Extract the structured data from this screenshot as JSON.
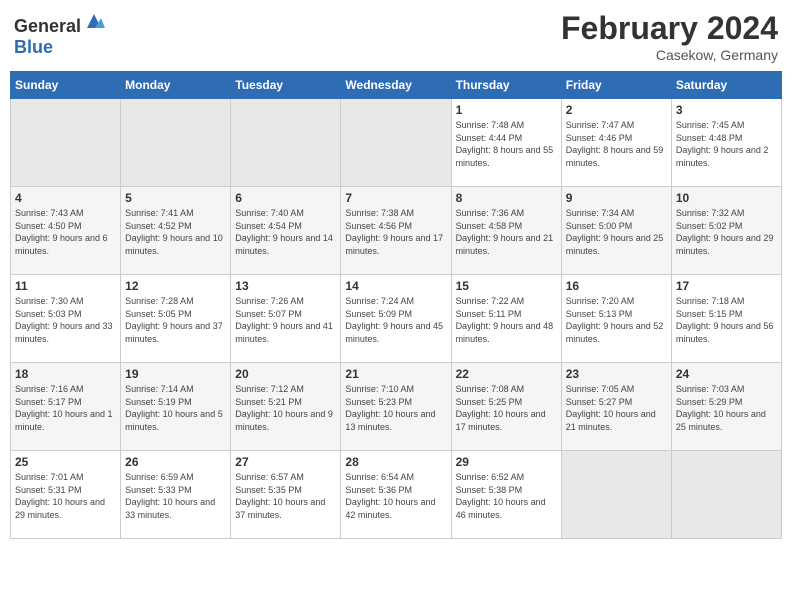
{
  "header": {
    "logo_general": "General",
    "logo_blue": "Blue",
    "title": "February 2024",
    "location": "Casekow, Germany"
  },
  "days_of_week": [
    "Sunday",
    "Monday",
    "Tuesday",
    "Wednesday",
    "Thursday",
    "Friday",
    "Saturday"
  ],
  "weeks": [
    [
      {
        "day": "",
        "sunrise": "",
        "sunset": "",
        "daylight": "",
        "empty": true
      },
      {
        "day": "",
        "sunrise": "",
        "sunset": "",
        "daylight": "",
        "empty": true
      },
      {
        "day": "",
        "sunrise": "",
        "sunset": "",
        "daylight": "",
        "empty": true
      },
      {
        "day": "",
        "sunrise": "",
        "sunset": "",
        "daylight": "",
        "empty": true
      },
      {
        "day": "1",
        "sunrise": "Sunrise: 7:48 AM",
        "sunset": "Sunset: 4:44 PM",
        "daylight": "Daylight: 8 hours and 55 minutes.",
        "empty": false
      },
      {
        "day": "2",
        "sunrise": "Sunrise: 7:47 AM",
        "sunset": "Sunset: 4:46 PM",
        "daylight": "Daylight: 8 hours and 59 minutes.",
        "empty": false
      },
      {
        "day": "3",
        "sunrise": "Sunrise: 7:45 AM",
        "sunset": "Sunset: 4:48 PM",
        "daylight": "Daylight: 9 hours and 2 minutes.",
        "empty": false
      }
    ],
    [
      {
        "day": "4",
        "sunrise": "Sunrise: 7:43 AM",
        "sunset": "Sunset: 4:50 PM",
        "daylight": "Daylight: 9 hours and 6 minutes.",
        "empty": false
      },
      {
        "day": "5",
        "sunrise": "Sunrise: 7:41 AM",
        "sunset": "Sunset: 4:52 PM",
        "daylight": "Daylight: 9 hours and 10 minutes.",
        "empty": false
      },
      {
        "day": "6",
        "sunrise": "Sunrise: 7:40 AM",
        "sunset": "Sunset: 4:54 PM",
        "daylight": "Daylight: 9 hours and 14 minutes.",
        "empty": false
      },
      {
        "day": "7",
        "sunrise": "Sunrise: 7:38 AM",
        "sunset": "Sunset: 4:56 PM",
        "daylight": "Daylight: 9 hours and 17 minutes.",
        "empty": false
      },
      {
        "day": "8",
        "sunrise": "Sunrise: 7:36 AM",
        "sunset": "Sunset: 4:58 PM",
        "daylight": "Daylight: 9 hours and 21 minutes.",
        "empty": false
      },
      {
        "day": "9",
        "sunrise": "Sunrise: 7:34 AM",
        "sunset": "Sunset: 5:00 PM",
        "daylight": "Daylight: 9 hours and 25 minutes.",
        "empty": false
      },
      {
        "day": "10",
        "sunrise": "Sunrise: 7:32 AM",
        "sunset": "Sunset: 5:02 PM",
        "daylight": "Daylight: 9 hours and 29 minutes.",
        "empty": false
      }
    ],
    [
      {
        "day": "11",
        "sunrise": "Sunrise: 7:30 AM",
        "sunset": "Sunset: 5:03 PM",
        "daylight": "Daylight: 9 hours and 33 minutes.",
        "empty": false
      },
      {
        "day": "12",
        "sunrise": "Sunrise: 7:28 AM",
        "sunset": "Sunset: 5:05 PM",
        "daylight": "Daylight: 9 hours and 37 minutes.",
        "empty": false
      },
      {
        "day": "13",
        "sunrise": "Sunrise: 7:26 AM",
        "sunset": "Sunset: 5:07 PM",
        "daylight": "Daylight: 9 hours and 41 minutes.",
        "empty": false
      },
      {
        "day": "14",
        "sunrise": "Sunrise: 7:24 AM",
        "sunset": "Sunset: 5:09 PM",
        "daylight": "Daylight: 9 hours and 45 minutes.",
        "empty": false
      },
      {
        "day": "15",
        "sunrise": "Sunrise: 7:22 AM",
        "sunset": "Sunset: 5:11 PM",
        "daylight": "Daylight: 9 hours and 48 minutes.",
        "empty": false
      },
      {
        "day": "16",
        "sunrise": "Sunrise: 7:20 AM",
        "sunset": "Sunset: 5:13 PM",
        "daylight": "Daylight: 9 hours and 52 minutes.",
        "empty": false
      },
      {
        "day": "17",
        "sunrise": "Sunrise: 7:18 AM",
        "sunset": "Sunset: 5:15 PM",
        "daylight": "Daylight: 9 hours and 56 minutes.",
        "empty": false
      }
    ],
    [
      {
        "day": "18",
        "sunrise": "Sunrise: 7:16 AM",
        "sunset": "Sunset: 5:17 PM",
        "daylight": "Daylight: 10 hours and 1 minute.",
        "empty": false
      },
      {
        "day": "19",
        "sunrise": "Sunrise: 7:14 AM",
        "sunset": "Sunset: 5:19 PM",
        "daylight": "Daylight: 10 hours and 5 minutes.",
        "empty": false
      },
      {
        "day": "20",
        "sunrise": "Sunrise: 7:12 AM",
        "sunset": "Sunset: 5:21 PM",
        "daylight": "Daylight: 10 hours and 9 minutes.",
        "empty": false
      },
      {
        "day": "21",
        "sunrise": "Sunrise: 7:10 AM",
        "sunset": "Sunset: 5:23 PM",
        "daylight": "Daylight: 10 hours and 13 minutes.",
        "empty": false
      },
      {
        "day": "22",
        "sunrise": "Sunrise: 7:08 AM",
        "sunset": "Sunset: 5:25 PM",
        "daylight": "Daylight: 10 hours and 17 minutes.",
        "empty": false
      },
      {
        "day": "23",
        "sunrise": "Sunrise: 7:05 AM",
        "sunset": "Sunset: 5:27 PM",
        "daylight": "Daylight: 10 hours and 21 minutes.",
        "empty": false
      },
      {
        "day": "24",
        "sunrise": "Sunrise: 7:03 AM",
        "sunset": "Sunset: 5:29 PM",
        "daylight": "Daylight: 10 hours and 25 minutes.",
        "empty": false
      }
    ],
    [
      {
        "day": "25",
        "sunrise": "Sunrise: 7:01 AM",
        "sunset": "Sunset: 5:31 PM",
        "daylight": "Daylight: 10 hours and 29 minutes.",
        "empty": false
      },
      {
        "day": "26",
        "sunrise": "Sunrise: 6:59 AM",
        "sunset": "Sunset: 5:33 PM",
        "daylight": "Daylight: 10 hours and 33 minutes.",
        "empty": false
      },
      {
        "day": "27",
        "sunrise": "Sunrise: 6:57 AM",
        "sunset": "Sunset: 5:35 PM",
        "daylight": "Daylight: 10 hours and 37 minutes.",
        "empty": false
      },
      {
        "day": "28",
        "sunrise": "Sunrise: 6:54 AM",
        "sunset": "Sunset: 5:36 PM",
        "daylight": "Daylight: 10 hours and 42 minutes.",
        "empty": false
      },
      {
        "day": "29",
        "sunrise": "Sunrise: 6:52 AM",
        "sunset": "Sunset: 5:38 PM",
        "daylight": "Daylight: 10 hours and 46 minutes.",
        "empty": false
      },
      {
        "day": "",
        "sunrise": "",
        "sunset": "",
        "daylight": "",
        "empty": true
      },
      {
        "day": "",
        "sunrise": "",
        "sunset": "",
        "daylight": "",
        "empty": true
      }
    ]
  ]
}
